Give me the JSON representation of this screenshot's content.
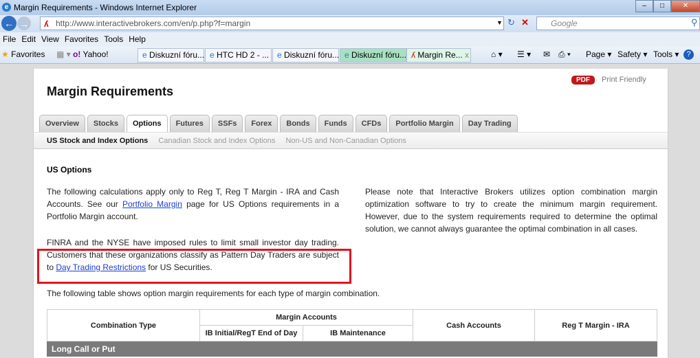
{
  "window": {
    "title": "Margin Requirements - Windows Internet Explorer"
  },
  "address": {
    "url": "http://www.interactivebrokers.com/en/p.php?f=margin",
    "search_placeholder": "Google"
  },
  "menu": [
    "File",
    "Edit",
    "View",
    "Favorites",
    "Tools",
    "Help"
  ],
  "favorites": {
    "label": "Favorites",
    "tabs": [
      "Yahoo!",
      "Diskuzní fóru...",
      "HTC HD 2 - ...",
      "Diskuzní fóru...",
      "Diskuzní fóru...",
      "Margin Re..."
    ],
    "commands": [
      "Page ▾",
      "Safety ▾",
      "Tools ▾"
    ]
  },
  "page": {
    "title": "Margin Requirements",
    "pdf": "PDF",
    "print": "Print Friendly",
    "tabs": [
      "Overview",
      "Stocks",
      "Options",
      "Futures",
      "SSFs",
      "Forex",
      "Bonds",
      "Funds",
      "CFDs",
      "Portfolio Margin",
      "Day Trading"
    ],
    "subtabs": [
      "US Stock and Index Options",
      "Canadian Stock and Index Options",
      "Non-US and Non-Canadian Options"
    ],
    "section": "US Options",
    "p1a": "The following calculations apply only to Reg T, Reg T Margin - IRA and Cash Accounts. See our ",
    "p1link": "Portfolio Margin",
    "p1b": " page for US Options requirements in a Portfolio Margin account.",
    "p2a": "FINRA and the NYSE have imposed rules to limit small investor day trading. Customers that these organizations classify as Pattern Day Traders are subject to ",
    "p2link": "Day Trading Restrictions",
    "p2b": " for US Securities.",
    "p3": "Please note that Interactive Brokers utilizes option combination margin optimization software to try to create the minimum margin requirement. However, due to the system requirements required to determine the optimal solution, we cannot always guarantee the optimal combination in all cases.",
    "p4": "The following table shows option margin requirements for each type of margin combination.",
    "table": {
      "combo": "Combination Type",
      "margin": "Margin Accounts",
      "initial": "IB Initial/RegT End of Day",
      "maint": "IB Maintenance",
      "cash": "Cash Accounts",
      "ira": "Reg T Margin - IRA",
      "row1": "Long Call or Put"
    }
  }
}
